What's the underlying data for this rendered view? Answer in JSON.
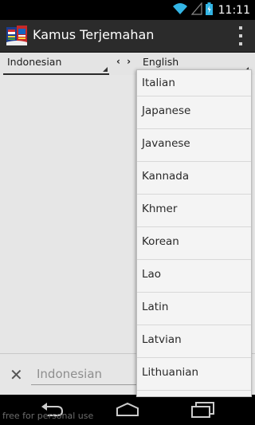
{
  "status_bar": {
    "time": "11:11",
    "icons": [
      "wifi-icon",
      "signal-icon",
      "battery-icon"
    ]
  },
  "action_bar": {
    "title": "Kamus Terjemahan",
    "icon": "app-icon",
    "overflow_icon": "overflow-menu-icon"
  },
  "language_bar": {
    "source_language": "Indonesian",
    "swap_label": "‹ ›",
    "target_language": "English"
  },
  "dropdown": {
    "items": [
      "Italian",
      "Japanese",
      "Javanese",
      "Kannada",
      "Khmer",
      "Korean",
      "Lao",
      "Latin",
      "Latvian",
      "Lithuanian"
    ]
  },
  "input_bar": {
    "clear_icon": "close-icon",
    "placeholder": "Indonesian"
  },
  "watermark": "free for personal use",
  "nav_bar": {
    "icons": [
      "back-icon",
      "home-icon",
      "recent-apps-icon"
    ]
  },
  "colors": {
    "action_bar_bg": "#2b2b2b",
    "content_bg": "#e6e6e6",
    "dropdown_bg": "#f4f4f4",
    "status_accent": "#33b5e5"
  }
}
